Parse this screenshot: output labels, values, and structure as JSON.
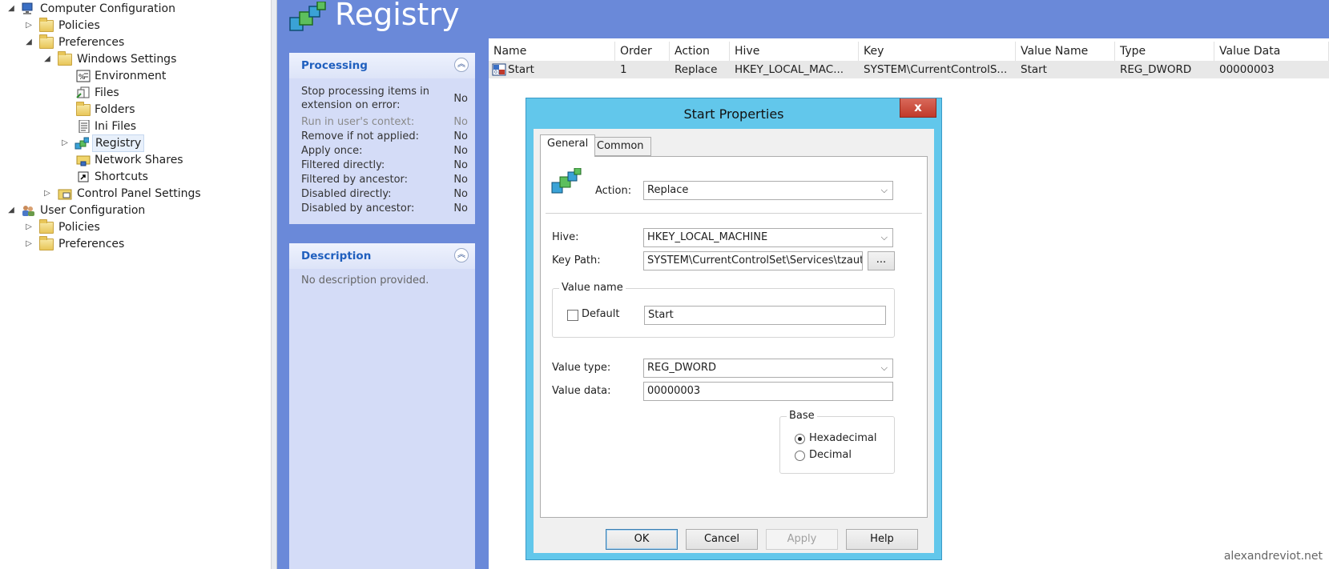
{
  "tree": {
    "items": [
      {
        "label": "Computer Configuration",
        "arrow": "◢"
      },
      {
        "label": "Policies",
        "arrow": "▷"
      },
      {
        "label": "Preferences",
        "arrow": "◢"
      },
      {
        "label": "Windows Settings",
        "arrow": "◢"
      },
      {
        "label": "Environment",
        "arrow": ""
      },
      {
        "label": "Files",
        "arrow": ""
      },
      {
        "label": "Folders",
        "arrow": ""
      },
      {
        "label": "Ini Files",
        "arrow": ""
      },
      {
        "label": "Registry",
        "arrow": "▷"
      },
      {
        "label": "Network Shares",
        "arrow": ""
      },
      {
        "label": "Shortcuts",
        "arrow": ""
      },
      {
        "label": "Control Panel Settings",
        "arrow": "▷"
      },
      {
        "label": "User Configuration",
        "arrow": "◢"
      },
      {
        "label": "Policies",
        "arrow": "▷"
      },
      {
        "label": "Preferences",
        "arrow": "▷"
      }
    ]
  },
  "header": {
    "title": "Registry"
  },
  "processing": {
    "title": "Processing",
    "rows": [
      {
        "label": "Stop processing items in extension on error:",
        "value": "No"
      },
      {
        "label": "Run in user's context:",
        "value": "No"
      },
      {
        "label": "Remove if not applied:",
        "value": "No"
      },
      {
        "label": "Apply once:",
        "value": "No"
      },
      {
        "label": "Filtered directly:",
        "value": "No"
      },
      {
        "label": "Filtered by ancestor:",
        "value": "No"
      },
      {
        "label": "Disabled directly:",
        "value": "No"
      },
      {
        "label": "Disabled by ancestor:",
        "value": "No"
      }
    ]
  },
  "description": {
    "title": "Description",
    "text": "No description provided."
  },
  "list": {
    "columns": [
      "Name",
      "Order",
      "Action",
      "Hive",
      "Key",
      "Value Name",
      "Type",
      "Value Data"
    ],
    "rows": [
      [
        "Start",
        "1",
        "Replace",
        "HKEY_LOCAL_MAC...",
        "SYSTEM\\CurrentControlS...",
        "Start",
        "REG_DWORD",
        "00000003"
      ]
    ]
  },
  "dialog": {
    "title": "Start Properties",
    "close": "x",
    "tabs": [
      "General",
      "Common"
    ],
    "action_label": "Action:",
    "action_value": "Replace",
    "hive_label": "Hive:",
    "hive_value": "HKEY_LOCAL_MACHINE",
    "keypath_label": "Key Path:",
    "keypath_value": "SYSTEM\\CurrentControlSet\\Services\\tzautoup",
    "browse_label": "...",
    "value_name_group": "Value name",
    "default_label": "Default",
    "value_name": "Start",
    "value_type_label": "Value type:",
    "value_type": "REG_DWORD",
    "value_data_label": "Value data:",
    "value_data": "00000003",
    "base_group": "Base",
    "hex_label": "Hexadecimal",
    "dec_label": "Decimal",
    "buttons": {
      "ok": "OK",
      "cancel": "Cancel",
      "apply": "Apply",
      "help": "Help"
    }
  },
  "watermark": "alexandreviot.net",
  "colors": {
    "header_bg": "#6a89d9",
    "card_bg": "#d4dcf7",
    "dialog_frame": "#62c7eb",
    "close_red": "#c03a2b"
  }
}
